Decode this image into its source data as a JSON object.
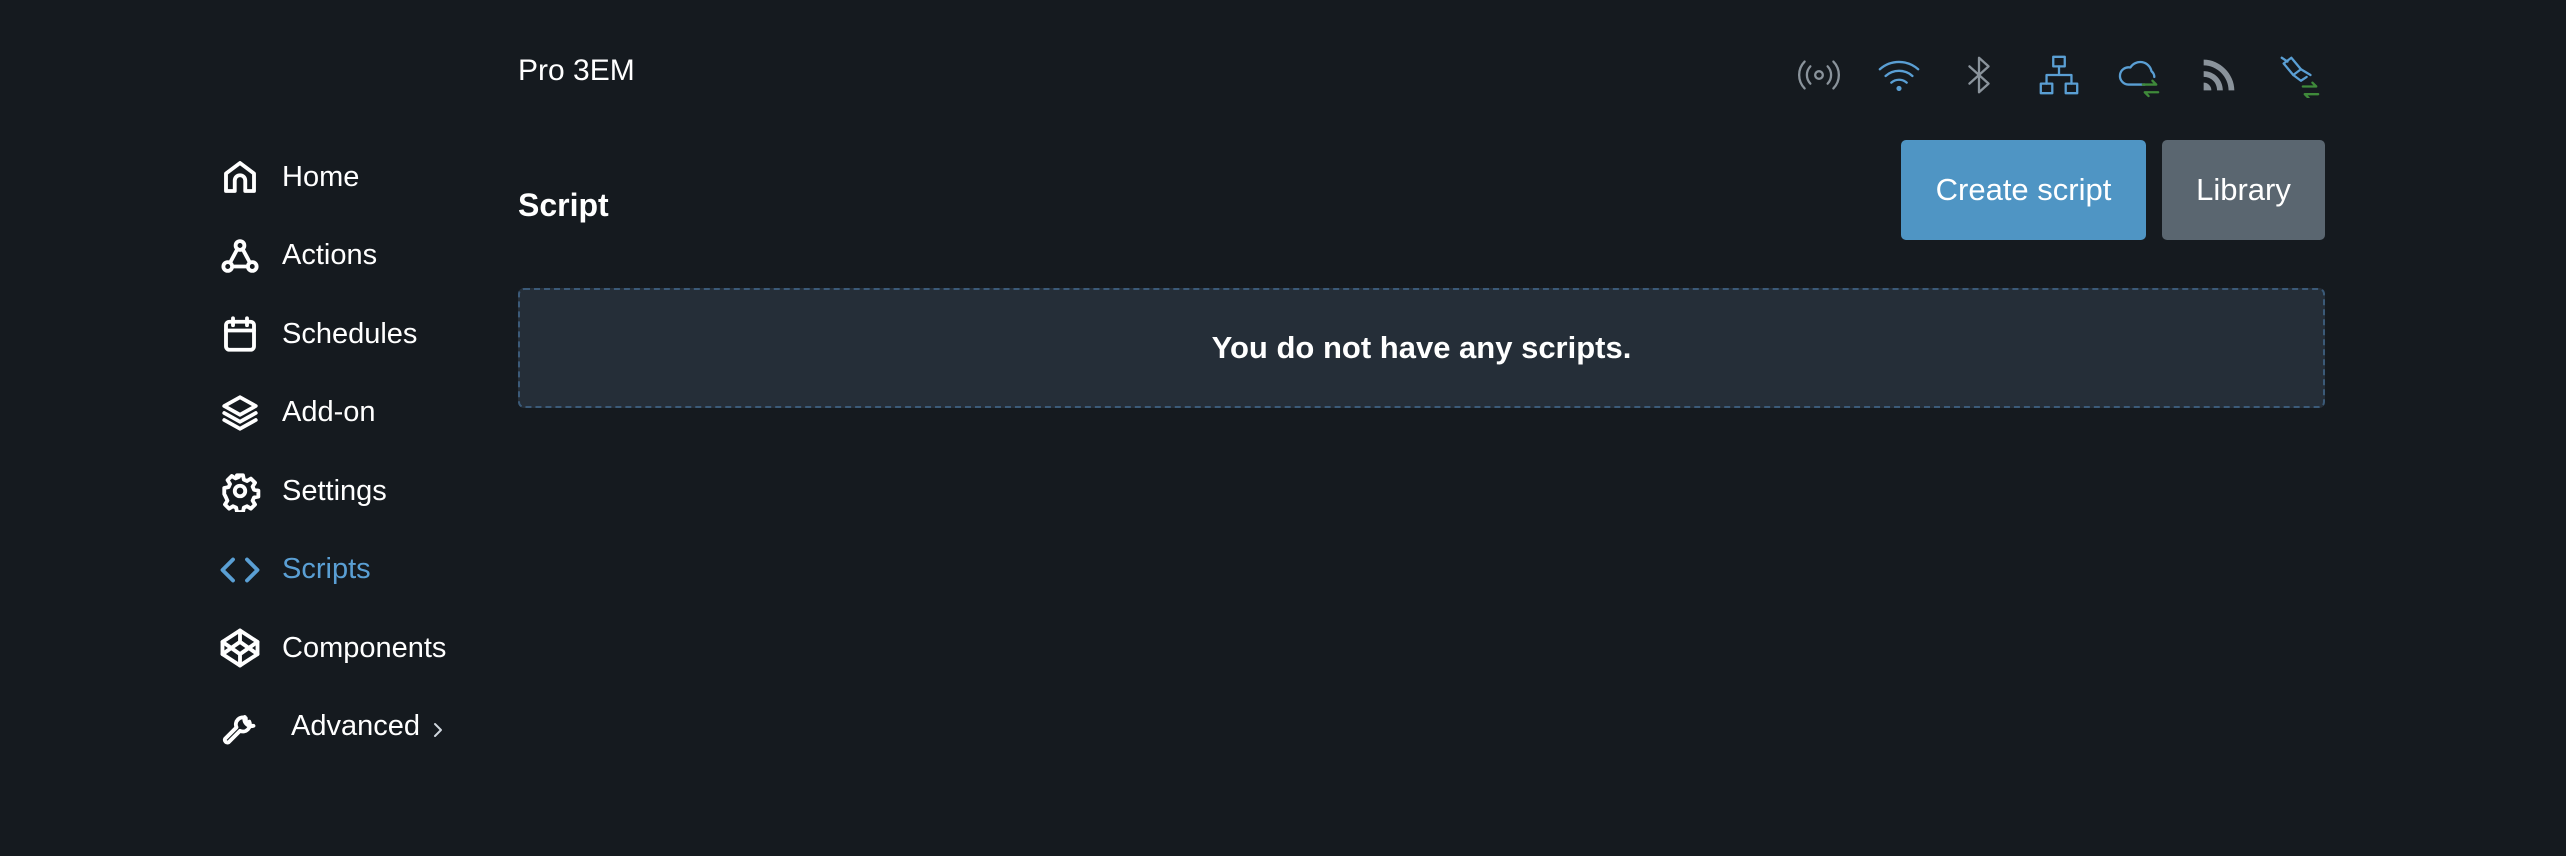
{
  "header": {
    "device_name": "Pro 3EM",
    "status_icons": [
      {
        "name": "broadcast-icon",
        "color": "#8a939b"
      },
      {
        "name": "wifi-icon",
        "color": "#5a9fd4"
      },
      {
        "name": "bluetooth-icon",
        "color": "#8a939b"
      },
      {
        "name": "network-icon",
        "color": "#5a9fd4"
      },
      {
        "name": "cloud-sync-icon",
        "color": "#5a9fd4"
      },
      {
        "name": "rss-icon",
        "color": "#8a939b"
      },
      {
        "name": "satellite-sync-icon",
        "color": "#5a9fd4"
      }
    ]
  },
  "sidebar": {
    "items": [
      {
        "label": "Home",
        "icon": "home-icon"
      },
      {
        "label": "Actions",
        "icon": "webhook-icon"
      },
      {
        "label": "Schedules",
        "icon": "calendar-icon"
      },
      {
        "label": "Add-on",
        "icon": "layers-icon"
      },
      {
        "label": "Settings",
        "icon": "gear-icon"
      },
      {
        "label": "Scripts",
        "icon": "code-icon",
        "active": true
      },
      {
        "label": "Components",
        "icon": "codepen-icon"
      },
      {
        "label": "Advanced",
        "icon": "wrench-icon"
      }
    ]
  },
  "main": {
    "title": "Script",
    "create_button": "Create script",
    "library_button": "Library",
    "empty_message": "You do not have any scripts."
  },
  "colors": {
    "background": "#151a1f",
    "accent": "#5a9fd4",
    "secondary_button": "#5a6670",
    "sync_green": "#3f8a3a"
  }
}
